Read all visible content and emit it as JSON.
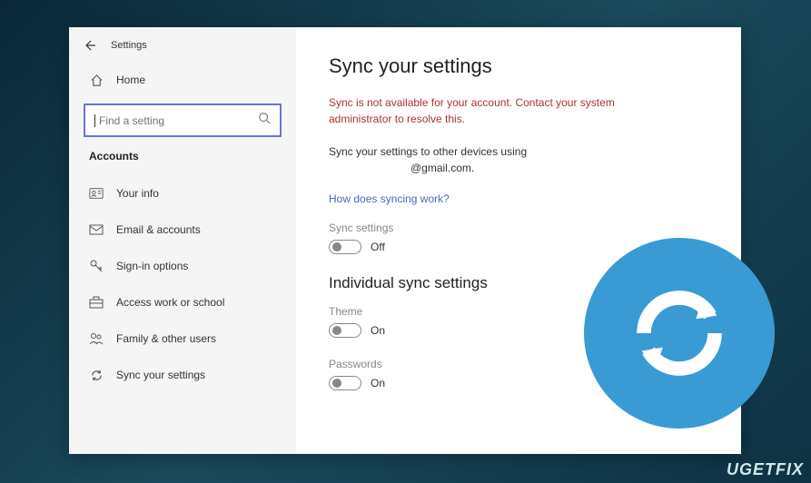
{
  "window": {
    "title": "Settings"
  },
  "sidebar": {
    "home_label": "Home",
    "search_placeholder": "Find a setting",
    "category": "Accounts",
    "items": [
      {
        "label": "Your info"
      },
      {
        "label": "Email & accounts"
      },
      {
        "label": "Sign-in options"
      },
      {
        "label": "Access work or school"
      },
      {
        "label": "Family & other users"
      },
      {
        "label": "Sync your settings"
      }
    ]
  },
  "main": {
    "title": "Sync your settings",
    "error": "Sync is not available for your account. Contact your system administrator to resolve this.",
    "desc_line1": "Sync your settings to other devices using",
    "desc_line2": "@gmail.com.",
    "link": "How does syncing work?",
    "sync_settings_label": "Sync settings",
    "sync_settings_state": "Off",
    "section_title": "Individual sync settings",
    "theme_label": "Theme",
    "theme_state": "On",
    "passwords_label": "Passwords",
    "passwords_state": "On"
  },
  "watermark": "UGETFIX"
}
